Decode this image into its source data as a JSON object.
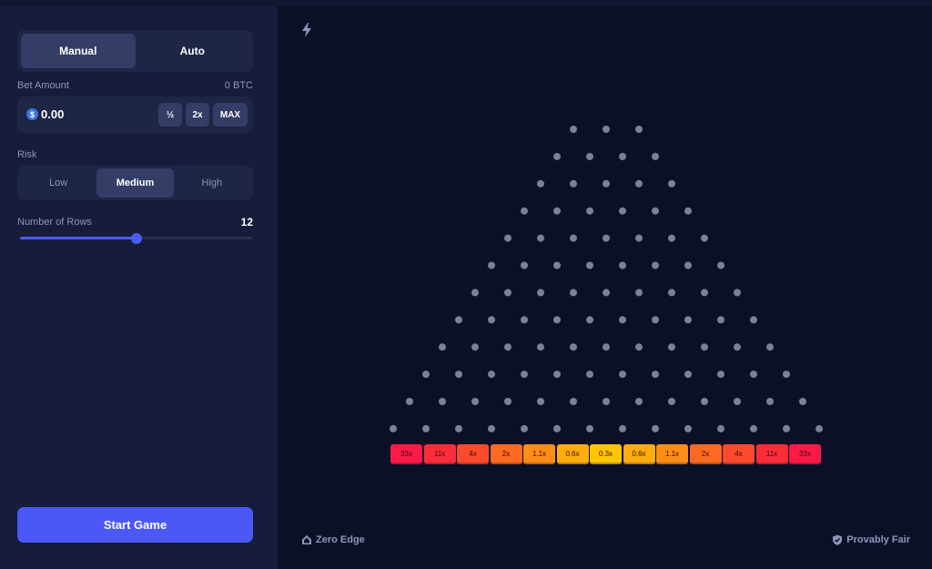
{
  "modes": {
    "manual": "Manual",
    "auto": "Auto"
  },
  "bet": {
    "label": "Bet Amount",
    "crypto_value": "0 BTC",
    "coin_symbol": "$",
    "amount": "0.00",
    "half_label": "½",
    "double_label": "2x",
    "max_label": "MAX"
  },
  "risk": {
    "label": "Risk",
    "low": "Low",
    "medium": "Medium",
    "high": "High",
    "selected": "Medium"
  },
  "rows": {
    "label": "Number of Rows",
    "value": "12",
    "min": 8,
    "max": 16,
    "count": 12
  },
  "start_button": "Start Game",
  "board": {
    "multipliers": [
      "33x",
      "11x",
      "4x",
      "2x",
      "1.1x",
      "0.6x",
      "0.3x",
      "0.6x",
      "1.1x",
      "2x",
      "4x",
      "11x",
      "33x"
    ],
    "bucket_colors": [
      "#fb1a48",
      "#fb2d3a",
      "#fc4a2c",
      "#fd6a22",
      "#fe8d18",
      "#ffad0e",
      "#ffc507",
      "#ffad0e",
      "#fe8d18",
      "#fd6a22",
      "#fc4a2c",
      "#fb2d3a",
      "#fb1a48"
    ],
    "peg_color": "#7d8194"
  },
  "footer": {
    "zero_edge": "Zero Edge",
    "provably_fair": "Provably Fair"
  },
  "colors": {
    "accent": "#4c58f5",
    "panel": "#161c39",
    "background": "#0c1027"
  },
  "icons": {
    "instant": "lightning-bolt-icon",
    "zero_edge": "home-icon",
    "provably_fair": "shield-check-icon",
    "coin": "dollar-coin-icon"
  }
}
